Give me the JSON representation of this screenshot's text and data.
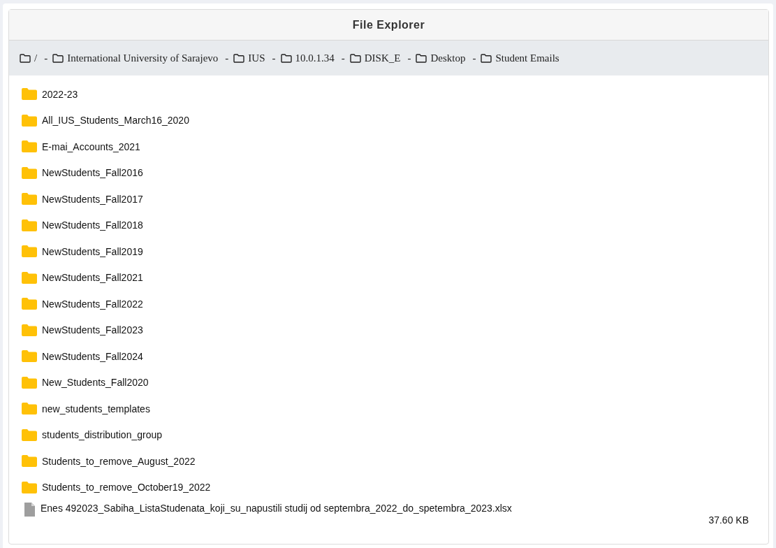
{
  "window": {
    "title": "File Explorer"
  },
  "breadcrumb": {
    "separator": "-",
    "items": [
      {
        "label": "/"
      },
      {
        "label": "International University of Sarajevo"
      },
      {
        "label": "IUS"
      },
      {
        "label": "10.0.1.34"
      },
      {
        "label": "DISK_E"
      },
      {
        "label": "Desktop"
      },
      {
        "label": "Student Emails"
      }
    ]
  },
  "entries": [
    {
      "kind": "folder",
      "name": "2022-23"
    },
    {
      "kind": "folder",
      "name": "All_IUS_Students_March16_2020"
    },
    {
      "kind": "folder",
      "name": "E-mai_Accounts_2021"
    },
    {
      "kind": "folder",
      "name": "NewStudents_Fall2016"
    },
    {
      "kind": "folder",
      "name": "NewStudents_Fall2017"
    },
    {
      "kind": "folder",
      "name": "NewStudents_Fall2018"
    },
    {
      "kind": "folder",
      "name": "NewStudents_Fall2019"
    },
    {
      "kind": "folder",
      "name": "NewStudents_Fall2021"
    },
    {
      "kind": "folder",
      "name": "NewStudents_Fall2022"
    },
    {
      "kind": "folder",
      "name": "NewStudents_Fall2023"
    },
    {
      "kind": "folder",
      "name": "NewStudents_Fall2024"
    },
    {
      "kind": "folder",
      "name": "New_Students_Fall2020"
    },
    {
      "kind": "folder",
      "name": "new_students_templates"
    },
    {
      "kind": "folder",
      "name": "students_distribution_group"
    },
    {
      "kind": "folder",
      "name": "Students_to_remove_August_2022"
    },
    {
      "kind": "folder",
      "name": "Students_to_remove_October19_2022"
    },
    {
      "kind": "file",
      "name": "Enes 492023_Sabiha_ListaStudenata_koji_su_napustili studij od septembra_2022_do_spetembra_2023.xlsx",
      "size": "37.60 KB"
    }
  ]
}
